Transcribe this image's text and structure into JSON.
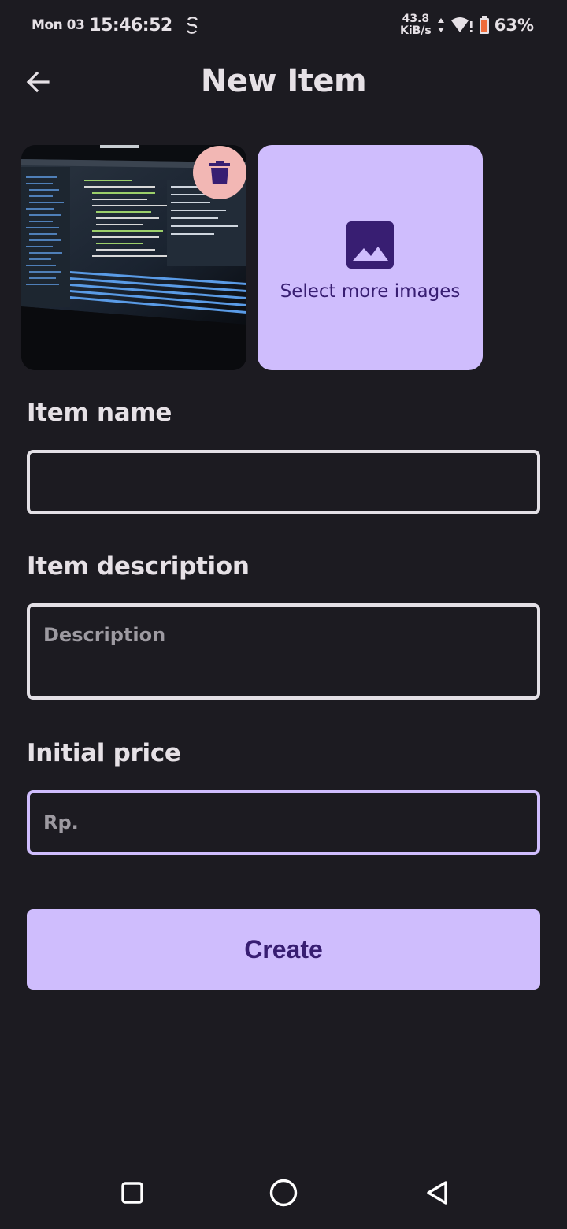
{
  "status_bar": {
    "date": "Mon 03",
    "time": "15:46:52",
    "net_speed_value": "43.8",
    "net_speed_unit": "KiB/s",
    "battery": "63%"
  },
  "header": {
    "title": "New Item"
  },
  "images": {
    "select_more_label": "Select more images"
  },
  "form": {
    "item_name": {
      "label": "Item name",
      "value": "",
      "placeholder": ""
    },
    "item_description": {
      "label": "Item description",
      "value": "",
      "placeholder": "Description"
    },
    "initial_price": {
      "label": "Initial price",
      "value": "",
      "placeholder": "Rp."
    }
  },
  "actions": {
    "create_label": "Create"
  },
  "colors": {
    "background": "#1c1b21",
    "accent": "#cfbdfd",
    "on_accent": "#381e72",
    "delete_bg": "#f2b7b4"
  }
}
